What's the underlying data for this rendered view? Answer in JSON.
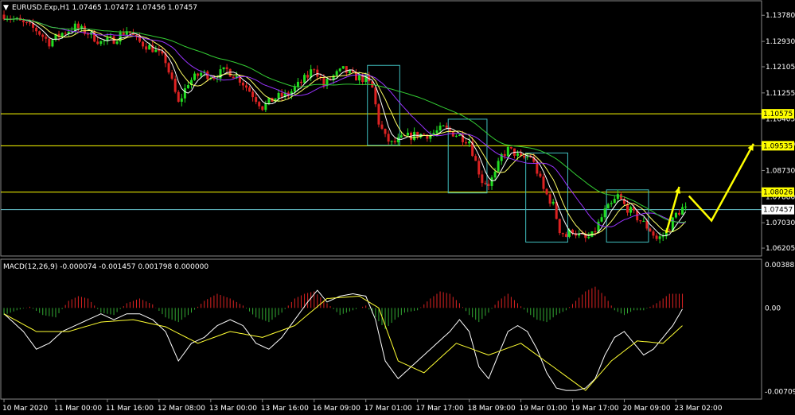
{
  "header": {
    "symbol_line": "EURUSD.Exp,H1  1.07465 1.07472 1.07456 1.07457"
  },
  "macd_header": "MACD(12,26,9) -0.000074 -0.001457 0.001798 0.000000",
  "colors": {
    "background": "#000000",
    "bull_candle": "#22dd22",
    "bear_candle": "#dd2222",
    "ma_fast": "#ffffff",
    "ma_mid": "#ffff66",
    "ma_slow": "#9933ff",
    "ma_long": "#33cc33",
    "level_line": "#ffff00",
    "price_line": "#66c2cc",
    "box": "#40c0c0",
    "arrow": "#ffff00",
    "macd_up": "#dd2222",
    "macd_down": "#33aa33",
    "macd_line": "#ffffff",
    "signal_line": "#ffff33"
  },
  "chart_data": [
    {
      "type": "candlestick",
      "panel": "price",
      "symbol": "EURUSD.Exp",
      "timeframe": "H1",
      "ylim": [
        1.06,
        1.142
      ],
      "y_ticks": [
        "1.13780",
        "1.12930",
        "1.12105",
        "1.11255",
        "1.10405",
        "1.09580",
        "1.08730",
        "1.07880",
        "1.07030",
        "1.06205"
      ],
      "x_ticks": [
        "10 Mar 2020",
        "11 Mar 00:00",
        "11 Mar 16:00",
        "12 Mar 08:00",
        "13 Mar 00:00",
        "13 Mar 16:00",
        "16 Mar 09:00",
        "17 Mar 01:00",
        "17 Mar 17:00",
        "18 Mar 09:00",
        "19 Mar 01:00",
        "19 Mar 17:00",
        "20 Mar 09:00",
        "23 Mar 02:00"
      ],
      "levels": [
        {
          "value": 1.10575,
          "label": "1.10575"
        },
        {
          "value": 1.09535,
          "label": "1.09535"
        },
        {
          "value": 1.08026,
          "label": "1.08026"
        }
      ],
      "current_price": {
        "value": 1.07457,
        "label": "1.07457"
      },
      "price_path": [
        [
          0,
          1.138
        ],
        [
          6,
          1.135
        ],
        [
          10,
          1.133
        ],
        [
          14,
          1.129
        ],
        [
          18,
          1.132
        ],
        [
          22,
          1.134
        ],
        [
          26,
          1.132
        ],
        [
          30,
          1.129
        ],
        [
          34,
          1.13
        ],
        [
          38,
          1.133
        ],
        [
          42,
          1.129
        ],
        [
          46,
          1.127
        ],
        [
          50,
          1.123
        ],
        [
          52,
          1.116
        ],
        [
          54,
          1.109
        ],
        [
          57,
          1.116
        ],
        [
          61,
          1.119
        ],
        [
          65,
          1.118
        ],
        [
          69,
          1.12
        ],
        [
          73,
          1.117
        ],
        [
          77,
          1.112
        ],
        [
          80,
          1.108
        ],
        [
          84,
          1.111
        ],
        [
          88,
          1.112
        ],
        [
          91,
          1.115
        ],
        [
          94,
          1.118
        ],
        [
          96,
          1.121
        ],
        [
          99,
          1.115
        ],
        [
          102,
          1.118
        ],
        [
          105,
          1.12
        ],
        [
          108,
          1.118
        ],
        [
          112,
          1.117
        ],
        [
          114,
          1.114
        ],
        [
          116,
          1.103
        ],
        [
          118,
          1.098
        ],
        [
          120,
          1.096
        ],
        [
          124,
          1.098
        ],
        [
          128,
          1.099
        ],
        [
          132,
          1.099
        ],
        [
          136,
          1.101
        ],
        [
          140,
          1.099
        ],
        [
          144,
          1.097
        ],
        [
          146,
          1.09
        ],
        [
          148,
          1.084
        ],
        [
          150,
          1.083
        ],
        [
          152,
          1.086
        ],
        [
          154,
          1.092
        ],
        [
          156,
          1.094
        ],
        [
          158,
          1.093
        ],
        [
          160,
          1.091
        ],
        [
          163,
          1.092
        ],
        [
          165,
          1.087
        ],
        [
          167,
          1.081
        ],
        [
          170,
          1.076
        ],
        [
          172,
          1.068
        ],
        [
          174,
          1.066
        ],
        [
          176,
          1.068
        ],
        [
          178,
          1.066
        ],
        [
          180,
          1.065
        ],
        [
          182,
          1.066
        ],
        [
          184,
          1.07
        ],
        [
          186,
          1.074
        ],
        [
          188,
          1.076
        ],
        [
          190,
          1.079
        ],
        [
          192,
          1.076
        ],
        [
          194,
          1.074
        ],
        [
          196,
          1.072
        ],
        [
          198,
          1.07
        ],
        [
          200,
          1.068
        ],
        [
          202,
          1.065
        ],
        [
          204,
          1.066
        ],
        [
          206,
          1.069
        ],
        [
          208,
          1.073
        ],
        [
          210,
          1.075
        ],
        [
          211,
          1.0746
        ]
      ],
      "boxes": [
        {
          "from": 113,
          "to": 123,
          "top": 1.1215,
          "bottom": 1.0955
        },
        {
          "from": 138,
          "to": 150,
          "top": 1.104,
          "bottom": 1.08
        },
        {
          "from": 162,
          "to": 175,
          "top": 1.093,
          "bottom": 1.064
        },
        {
          "from": 187,
          "to": 200,
          "top": 1.081,
          "bottom": 1.064
        }
      ],
      "forecast_arrows": [
        {
          "from": [
            205,
            1.067
          ],
          "to": [
            209,
            1.082
          ]
        },
        {
          "from": [
            212,
            1.079
          ],
          "to": [
            219,
            1.071
          ],
          "to2": [
            232,
            1.096
          ]
        }
      ]
    },
    {
      "type": "histogram",
      "panel": "macd",
      "title": "MACD(12,26,9)",
      "values": {
        "macd": -7.4e-05,
        "signal": -0.001457,
        "histogram_max": 0.001798
      },
      "y_ticks": [
        "0.003887",
        "0.00",
        "-0.00709"
      ],
      "ylim": [
        -0.0076,
        0.004
      ],
      "macd_path": [
        [
          0,
          -0.0005
        ],
        [
          6,
          -0.002
        ],
        [
          10,
          -0.0035
        ],
        [
          14,
          -0.003
        ],
        [
          18,
          -0.002
        ],
        [
          22,
          -0.0015
        ],
        [
          26,
          -0.001
        ],
        [
          30,
          -0.0005
        ],
        [
          34,
          -0.001
        ],
        [
          38,
          -0.0005
        ],
        [
          42,
          -0.0005
        ],
        [
          46,
          -0.001
        ],
        [
          50,
          -0.002
        ],
        [
          54,
          -0.0045
        ],
        [
          58,
          -0.003
        ],
        [
          62,
          -0.0025
        ],
        [
          66,
          -0.0015
        ],
        [
          70,
          -0.001
        ],
        [
          74,
          -0.0015
        ],
        [
          78,
          -0.003
        ],
        [
          82,
          -0.0035
        ],
        [
          86,
          -0.0025
        ],
        [
          90,
          -0.001
        ],
        [
          94,
          0.0005
        ],
        [
          97,
          0.0015
        ],
        [
          100,
          0.0005
        ],
        [
          104,
          0.001
        ],
        [
          108,
          0.0012
        ],
        [
          112,
          0.001
        ],
        [
          115,
          -0.001
        ],
        [
          118,
          -0.0045
        ],
        [
          122,
          -0.006
        ],
        [
          126,
          -0.005
        ],
        [
          130,
          -0.004
        ],
        [
          134,
          -0.003
        ],
        [
          138,
          -0.002
        ],
        [
          141,
          -0.001
        ],
        [
          144,
          -0.002
        ],
        [
          147,
          -0.005
        ],
        [
          150,
          -0.006
        ],
        [
          153,
          -0.004
        ],
        [
          156,
          -0.002
        ],
        [
          159,
          -0.0015
        ],
        [
          162,
          -0.002
        ],
        [
          165,
          -0.0035
        ],
        [
          168,
          -0.0055
        ],
        [
          171,
          -0.0068
        ],
        [
          174,
          -0.007
        ],
        [
          177,
          -0.007
        ],
        [
          180,
          -0.0068
        ],
        [
          183,
          -0.006
        ],
        [
          186,
          -0.004
        ],
        [
          189,
          -0.0025
        ],
        [
          192,
          -0.002
        ],
        [
          195,
          -0.003
        ],
        [
          198,
          -0.004
        ],
        [
          201,
          -0.0035
        ],
        [
          204,
          -0.0025
        ],
        [
          207,
          -0.0015
        ],
        [
          210,
          -0.0001
        ]
      ],
      "signal_path": [
        [
          0,
          -0.0005
        ],
        [
          10,
          -0.002
        ],
        [
          20,
          -0.002
        ],
        [
          30,
          -0.0012
        ],
        [
          40,
          -0.001
        ],
        [
          50,
          -0.0016
        ],
        [
          60,
          -0.003
        ],
        [
          70,
          -0.002
        ],
        [
          80,
          -0.0025
        ],
        [
          90,
          -0.0015
        ],
        [
          100,
          0.0008
        ],
        [
          110,
          0.001
        ],
        [
          116,
          0.0
        ],
        [
          122,
          -0.0045
        ],
        [
          130,
          -0.0055
        ],
        [
          140,
          -0.003
        ],
        [
          150,
          -0.004
        ],
        [
          160,
          -0.003
        ],
        [
          170,
          -0.005
        ],
        [
          180,
          -0.007
        ],
        [
          188,
          -0.0045
        ],
        [
          196,
          -0.0028
        ],
        [
          204,
          -0.003
        ],
        [
          210,
          -0.0015
        ]
      ],
      "histogram": [
        [
          0,
          -0.0006
        ],
        [
          4,
          -0.0002
        ],
        [
          8,
          0.0001
        ],
        [
          12,
          -0.0006
        ],
        [
          16,
          -0.0008
        ],
        [
          20,
          0.0006
        ],
        [
          23,
          0.001
        ],
        [
          26,
          0.0008
        ],
        [
          30,
          -0.0004
        ],
        [
          34,
          -0.0006
        ],
        [
          38,
          0.0004
        ],
        [
          42,
          0.0008
        ],
        [
          46,
          0.0003
        ],
        [
          50,
          -0.0008
        ],
        [
          54,
          -0.0012
        ],
        [
          58,
          -0.0004
        ],
        [
          62,
          0.0006
        ],
        [
          66,
          0.0012
        ],
        [
          70,
          0.0008
        ],
        [
          74,
          0.0002
        ],
        [
          78,
          -0.0008
        ],
        [
          82,
          -0.0012
        ],
        [
          86,
          -0.0004
        ],
        [
          90,
          0.0008
        ],
        [
          93,
          0.0012
        ],
        [
          96,
          0.0014
        ],
        [
          100,
          0.0004
        ],
        [
          104,
          -0.0006
        ],
        [
          108,
          -0.0002
        ],
        [
          112,
          0.0002
        ],
        [
          115,
          -0.0008
        ],
        [
          118,
          -0.0018
        ],
        [
          121,
          -0.001
        ],
        [
          124,
          -0.0004
        ],
        [
          128,
          -0.0002
        ],
        [
          132,
          0.0008
        ],
        [
          135,
          0.0014
        ],
        [
          138,
          0.0012
        ],
        [
          141,
          0.0004
        ],
        [
          144,
          -0.0006
        ],
        [
          147,
          -0.0012
        ],
        [
          150,
          -0.0004
        ],
        [
          153,
          0.0006
        ],
        [
          156,
          0.0012
        ],
        [
          159,
          0.0004
        ],
        [
          162,
          -0.0004
        ],
        [
          165,
          -0.001
        ],
        [
          168,
          -0.0012
        ],
        [
          171,
          -0.0006
        ],
        [
          174,
          -0.0002
        ],
        [
          177,
          0.0006
        ],
        [
          180,
          0.0014
        ],
        [
          183,
          0.0018
        ],
        [
          186,
          0.001
        ],
        [
          189,
          -0.0002
        ],
        [
          192,
          -0.0006
        ],
        [
          195,
          -0.0002
        ],
        [
          198,
          -0.0002
        ],
        [
          202,
          0.0004
        ],
        [
          206,
          0.0012
        ],
        [
          210,
          0.0012
        ]
      ]
    }
  ]
}
